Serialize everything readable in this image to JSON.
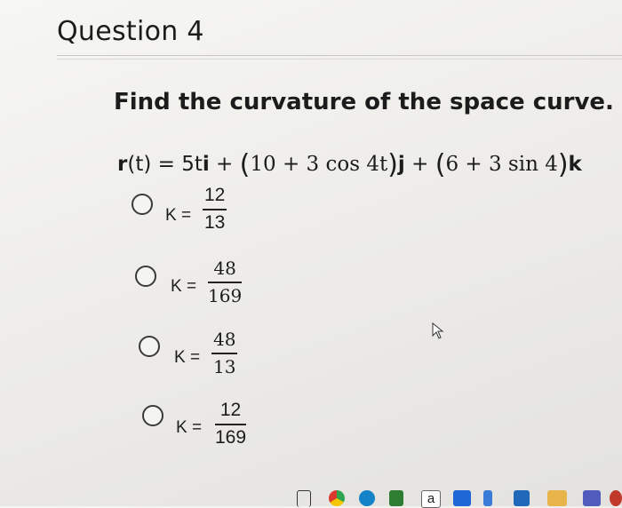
{
  "question": {
    "title": "Question 4",
    "prompt": "Find the curvature of the space curve.",
    "formula": {
      "lhs": "r",
      "lhs_arg": "(t) = 5t",
      "i": "i",
      "plus1": " + ",
      "j_term": "10 + 3 cos 4t",
      "j": "j",
      "plus2": " + ",
      "k_term": "6 + 3 sin 4",
      "k": "k"
    },
    "options": [
      {
        "label": "K =",
        "numerator": "12",
        "denominator": "13"
      },
      {
        "label": "K =",
        "numerator": "48",
        "denominator": "169"
      },
      {
        "label": "K =",
        "numerator": "48",
        "denominator": "13"
      },
      {
        "label": "K =",
        "numerator": "12",
        "denominator": "169"
      }
    ]
  },
  "taskbar": {
    "icons": [
      "file-explorer-icon",
      "chrome-icon",
      "edge-icon",
      "store-icon",
      "word-a-icon",
      "dropbox-icon",
      "arrow-icon",
      "app-icon",
      "folder-icon",
      "teams-icon"
    ],
    "letter_label": "a"
  }
}
